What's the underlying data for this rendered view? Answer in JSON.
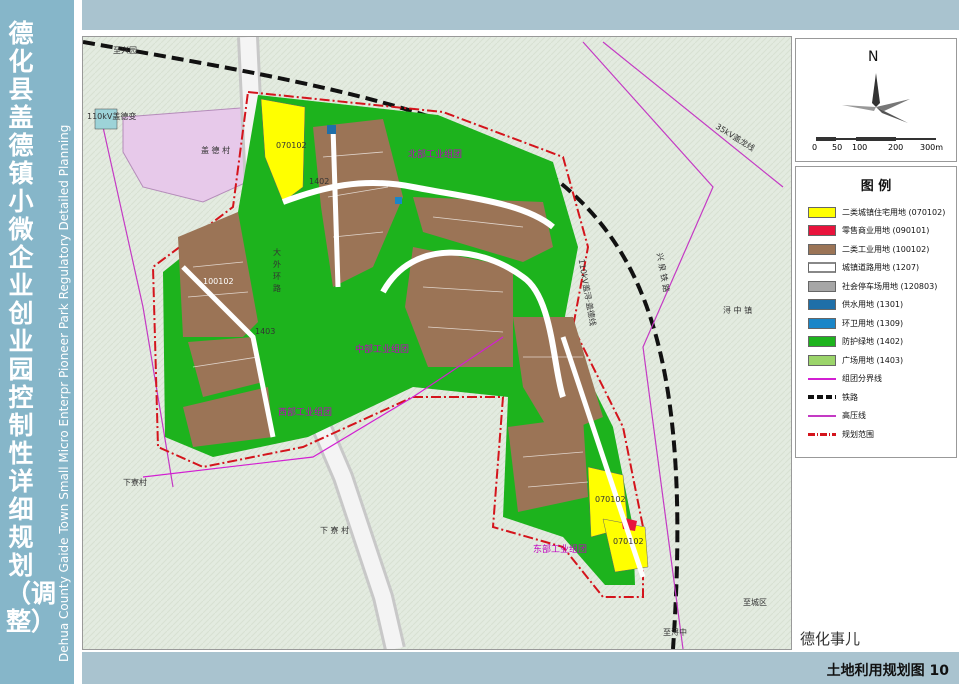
{
  "side": {
    "title": "德化县盖德镇小微企业创业园控制性详细规划（调整）",
    "subtitle": "Dehua County Gaide Town Small Micro Enterpr Pioneer Park Regulatory Detailed Planning"
  },
  "footer": {
    "label": "土地利用规划图 10",
    "watermark": "德化事儿"
  },
  "compass": {
    "north": "N",
    "scale": [
      "0",
      "50",
      "100",
      "200",
      "300m"
    ]
  },
  "legend": {
    "title": "图 例",
    "items": [
      {
        "label": "二类城镇住宅用地 (070102)",
        "color": "#ffff00",
        "kind": "fill"
      },
      {
        "label": "零售商业用地 (090101)",
        "color": "#e8133c",
        "kind": "fill"
      },
      {
        "label": "二类工业用地 (100102)",
        "color": "#9b7456",
        "kind": "fill"
      },
      {
        "label": "城镇道路用地 (1207)",
        "color": "#ffffff",
        "kind": "road"
      },
      {
        "label": "社会停车场用地 (120803)",
        "color": "#a6a6a6",
        "kind": "fill"
      },
      {
        "label": "供水用地 (1301)",
        "color": "#1f6fa8",
        "kind": "fill"
      },
      {
        "label": "环卫用地 (1309)",
        "color": "#1a86c8",
        "kind": "fill"
      },
      {
        "label": "防护绿地 (1402)",
        "color": "#1db31d",
        "kind": "fill"
      },
      {
        "label": "广场用地 (1403)",
        "color": "#9bd46a",
        "kind": "fill"
      },
      {
        "label": "组团分界线",
        "color": "#d21fd2",
        "kind": "line"
      },
      {
        "label": "铁路",
        "color": "#111111",
        "kind": "rail"
      },
      {
        "label": "高压线",
        "color": "#c43ac4",
        "kind": "line"
      },
      {
        "label": "规划范围",
        "color": "#d4141c",
        "kind": "dashdot"
      }
    ]
  },
  "map": {
    "place_labels": {
      "gaide_village": "盖 德 村",
      "xia_liao_village": "下 寮 村",
      "xia_liao_hill": "下寮村",
      "xun_zhong_town": "浔 中 镇",
      "substation": "110kV盖德变",
      "road_big_ring": "大外环路",
      "line_35kv": "35kV盖龙线",
      "line_110kv": "110kV盖浔·盖德线",
      "railway_label": "兴 泉 铁 路",
      "top_road": "至兴园",
      "east_exit": "至城区",
      "south_exit": "至浔中"
    },
    "clusters": {
      "north": "北部工业组团",
      "middle": "中部工业组团",
      "west": "西部工业组团",
      "east": "东部工业组团"
    },
    "parcel_codes": {
      "residential_north": "070102",
      "residential_east_1": "070102",
      "residential_east_2": "070102",
      "commercial": "090101",
      "industrial": "100102",
      "green": "1402",
      "plaza": "1403"
    }
  },
  "colors": {
    "industrial": "#9b7456",
    "green": "#1db31d",
    "residential": "#ffff00",
    "commercial": "#e8133c",
    "boundary": "#d4141c",
    "cluster_line": "#d21fd2",
    "road": "#ffffff",
    "terrain": "#dfe8d9"
  }
}
